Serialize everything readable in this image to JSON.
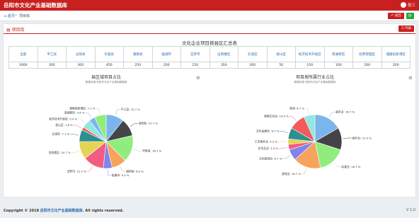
{
  "app": {
    "title": "岳阳市文化产业基础数据库",
    "user_name": "张三"
  },
  "breadcrumb": {
    "home": "首页",
    "separator": ">",
    "current": "项目库"
  },
  "toolbar": {
    "back_label": "返回",
    "refresh_icon": "refresh-icon"
  },
  "panel": {
    "title": "项目库",
    "list_button": "列表"
  },
  "stats_table": {
    "title": "文化企业项目按县区汇总表",
    "headers": [
      "全部",
      "平江县",
      "岳阳县",
      "华容县",
      "湘阴县",
      "临湘市",
      "汨罗市",
      "岳阳楼区",
      "云溪区",
      "君山区",
      "经济技术开发区",
      "南湖新区",
      "屈原管理区",
      "城陵矶新港区"
    ],
    "values": [
      "3000",
      "300",
      "300",
      "450",
      "250",
      "200",
      "150",
      "350",
      "300",
      "50",
      "150",
      "100",
      "200",
      "200"
    ]
  },
  "chart_data": [
    {
      "type": "pie",
      "title": "县区域项目占比",
      "subtitle": "数据来源:岳阳市文化产业基础数据库",
      "labels": [
        "平江县",
        "岳阳县",
        "华容县",
        "湘阴县",
        "临湘市",
        "汨罗市",
        "岳阳楼区",
        "云溪区",
        "君山区",
        "经济技术开发区",
        "南湖新区",
        "屈原管理区",
        "城陵矶新港区"
      ],
      "values": [
        10.7,
        10.7,
        16.1,
        8.9,
        5.4,
        12.5,
        10.7,
        7.1,
        1.8,
        5.4,
        3.6,
        0.0,
        7.1
      ],
      "display_labels": [
        "平江县: 10.7 %",
        "岳阳县: 10.7 %",
        "华容县: 16.1 %",
        "湘阴县: 8.9 %",
        "临湘市: 5.4 %",
        "汨罗市: 12.5 %",
        "岳阳楼区: 10.7 %",
        "云溪区: 7.1 %",
        "君山区: 1.8 %",
        "经济技术开发区: 5.4 %",
        "南湖新区: 3.6 %",
        "",
        "城陵矶新港区: 7.1 %"
      ],
      "colors": [
        "#7cb5ec",
        "#434348",
        "#90ed7d",
        "#f7a35c",
        "#8085e9",
        "#f15c80",
        "#e4d354",
        "#2b908f",
        "#f45b5b",
        "#91e8e1",
        "#7cb5ec",
        "#434348",
        "#90ed7d"
      ]
    },
    {
      "type": "pie",
      "title": "项目按所属行业占比",
      "subtitle": "数据来源:岳阳市文化产业基础数据库",
      "labels": [
        "演艺业",
        "娱乐业",
        "动漫业",
        "游戏业",
        "文化旅游业",
        "艺术品业",
        "工艺美术业",
        "文化会展业",
        "网络文化业",
        "其他"
      ],
      "values": [
        16.7,
        13.3,
        16.7,
        16.7,
        6.7,
        3.3,
        3.3,
        6.7,
        10.0,
        6.7
      ],
      "display_labels": [
        "演艺业: 16.7 %",
        "娱乐业: 13.3 %",
        "动漫业: 16.7 %",
        "游戏业: 16.7 %",
        "文化旅游业: 6.7 %",
        "艺术品业: 3.3 %",
        "工艺美术业: 3.3 %",
        "文化会展业: 6.7 %",
        "网络文化业: 10.0 %",
        "其他: 6.7 %"
      ],
      "colors": [
        "#7cb5ec",
        "#434348",
        "#90ed7d",
        "#f7a35c",
        "#8085e9",
        "#f15c80",
        "#e4d354",
        "#2b908f",
        "#f45b5b",
        "#91e8e1"
      ]
    }
  ],
  "footer": {
    "prefix": "Copyright © 2018",
    "link": "岳阳市文化产业基础数据库",
    "suffix": ". All rights reserved.",
    "version": "V 1.0"
  }
}
